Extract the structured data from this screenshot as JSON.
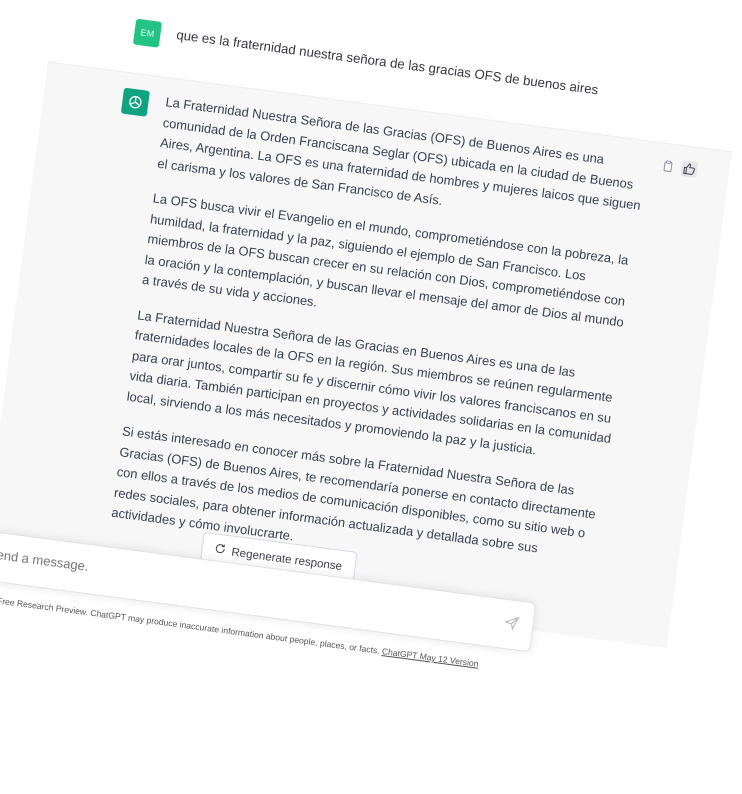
{
  "user_message": {
    "avatar_initials": "EM",
    "text": "que es la fraternidad nuestra señora de las gracias OFS de buenos aires"
  },
  "assistant_message": {
    "paragraphs": [
      "La Fraternidad Nuestra Señora de las Gracias (OFS) de Buenos Aires es una comunidad de la Orden Franciscana Seglar (OFS) ubicada en la ciudad de Buenos Aires, Argentina. La OFS es una fraternidad de hombres y mujeres laicos que siguen el carisma y los valores de San Francisco de Asís.",
      "La OFS busca vivir el Evangelio en el mundo, comprometiéndose con la pobreza, la humildad, la fraternidad y la paz, siguiendo el ejemplo de San Francisco. Los miembros de la OFS buscan crecer en su relación con Dios, comprometiéndose con la oración y la contemplación, y buscan llevar el mensaje del amor de Dios al mundo a través de su vida y acciones.",
      "La Fraternidad Nuestra Señora de las Gracias en Buenos Aires es una de las fraternidades locales de la OFS en la región. Sus miembros se reúnen regularmente para orar juntos, compartir su fe y discernir cómo vivir los valores franciscanos en su vida diaria. También participan en proyectos y actividades solidarias en la comunidad local, sirviendo a los más necesitados y promoviendo la paz y la justicia.",
      "Si estás interesado en conocer más sobre la Fraternidad Nuestra Señora de las Gracias (OFS) de Buenos Aires, te recomendaría ponerse en contacto directamente con ellos a través de los medios de comunicación disponibles, como su sitio web o redes sociales, para obtener información actualizada y detallada sobre sus actividades y cómo involucrarte."
    ]
  },
  "controls": {
    "regenerate_label": "Regenerate response",
    "input_placeholder": "Send a message."
  },
  "footer": {
    "text": "Free Research Preview. ChatGPT may produce inaccurate information about people, places, or facts. ",
    "link": "ChatGPT May 12 Version"
  },
  "colors": {
    "user_avatar": "#23c483",
    "assistant_avatar": "#10a37f",
    "assistant_bg": "#f7f7f8"
  },
  "icons": [
    "openai-logo-icon",
    "copy-icon",
    "thumbs-up-icon",
    "refresh-icon",
    "send-icon"
  ]
}
